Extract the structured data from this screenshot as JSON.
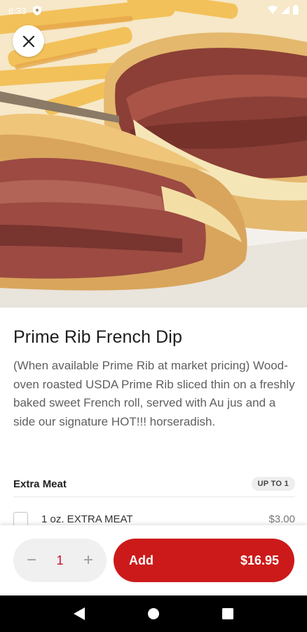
{
  "status_bar": {
    "time": "6:33",
    "icons": [
      "shield-icon",
      "wifi-icon",
      "signal-icon",
      "battery-icon"
    ]
  },
  "hero": {
    "image": "prime-rib-french-dip-photo",
    "close_icon": "close-icon"
  },
  "item": {
    "title": "Prime Rib French Dip",
    "description": "(When available Prime Rib at market pricing) Wood-oven roasted USDA Prime Rib sliced thin on a freshly baked sweet French roll, served with Au jus and a side our signature HOT!!! horseradish."
  },
  "options": {
    "group_title": "Extra Meat",
    "limit_badge": "UP TO 1",
    "choices": [
      {
        "label": "1 oz. EXTRA MEAT",
        "price": "$3.00",
        "checked": false
      }
    ]
  },
  "action_bar": {
    "minus_label": "−",
    "quantity": "1",
    "plus_label": "+",
    "add_label": "Add",
    "add_price": "$16.95"
  },
  "nav_bar": {
    "icons": [
      "back-icon",
      "home-icon",
      "recents-icon"
    ]
  },
  "colors": {
    "accent": "#cc1a1a",
    "quantity_text": "#c8102e",
    "stepper_bg": "#f0f0f0",
    "badge_bg": "#eeeeee"
  }
}
